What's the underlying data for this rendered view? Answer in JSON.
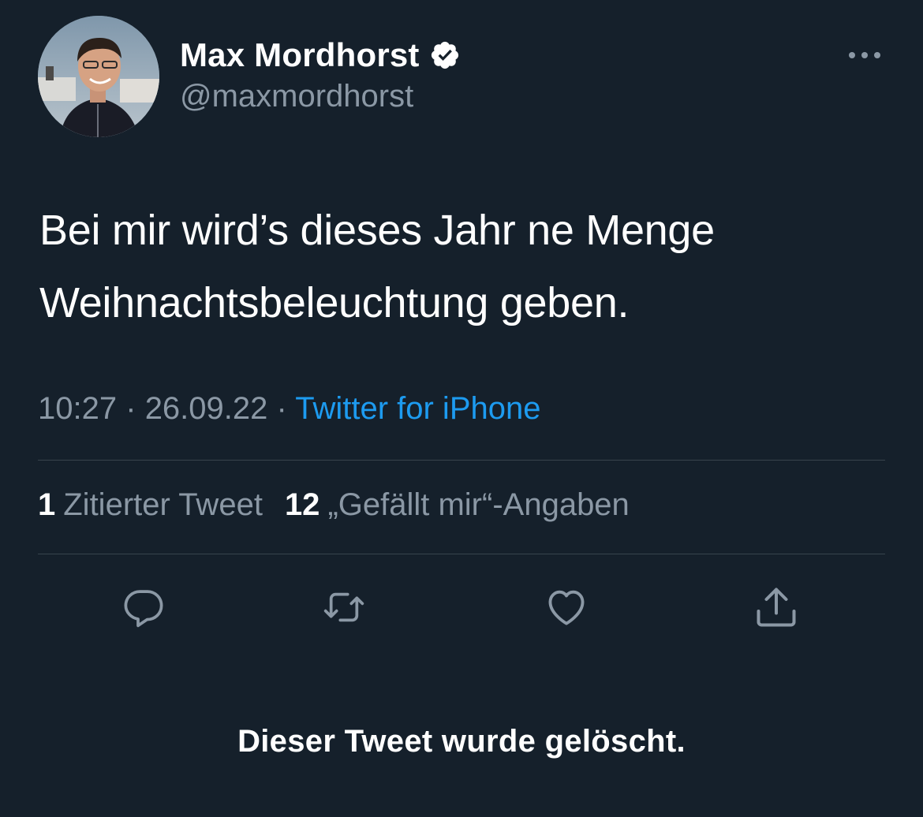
{
  "tweet": {
    "author": {
      "display_name": "Max Mordhorst",
      "handle": "@maxmordhorst",
      "verified": true
    },
    "text_lines": [
      "Bei mir wird’s dieses Jahr ne Menge",
      "Weihnachtsbeleuchtung geben."
    ],
    "time": "10:27",
    "date": "26.09.22",
    "separator": "·",
    "source": "Twitter for iPhone",
    "stats": {
      "quote_count": "1",
      "quote_label": "Zitierter Tweet",
      "like_count": "12",
      "like_label": "„Gefällt mir“-Angaben"
    },
    "notice": "Dieser Tweet wurde gelöscht."
  },
  "icons": {
    "more": "more-horizontal-icon",
    "verified": "verified-badge-icon",
    "reply": "reply-bubble-icon",
    "retweet": "retweet-icon",
    "like": "heart-icon",
    "share": "share-upload-icon"
  },
  "colors": {
    "background": "#15202b",
    "text_primary": "#ffffff",
    "text_secondary": "#8b98a5",
    "link": "#1d9bf0",
    "divider": "#38444d",
    "icon": "#8b98a5"
  }
}
